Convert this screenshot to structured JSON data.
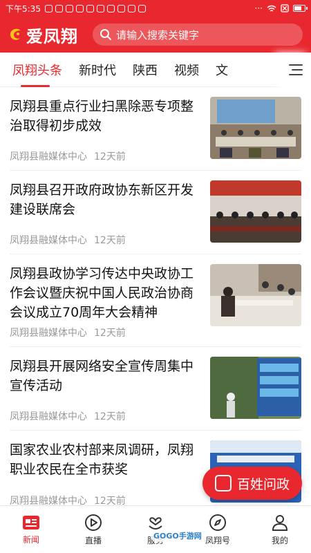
{
  "status_bar": {
    "time": "下午5:35"
  },
  "header": {
    "app_name": "爱凤翔",
    "search_placeholder": "请输入搜索关键字"
  },
  "tabs": [
    "凤翔头条",
    "新时代",
    "陕西",
    "视频",
    "文"
  ],
  "feed": [
    {
      "title": "凤翔县重点行业扫黑除恶专项整治取得初步成效",
      "source": "凤翔县融媒体中心",
      "time": "12天前"
    },
    {
      "title": "凤翔县召开政府政协东新区开发建设联席会",
      "source": "凤翔县融媒体中心",
      "time": "12天前"
    },
    {
      "title": "凤翔县政协学习传达中央政协工作会议暨庆祝中国人民政治协商会议成立70周年大会精神",
      "source": "凤翔县融媒体中心",
      "time": "12天前"
    },
    {
      "title": "凤翔县开展网络安全宣传周集中宣传活动",
      "source": "凤翔县融媒体中心",
      "time": "12天前"
    },
    {
      "title": "国家农业农村部来凤调研，凤翔职业农民在全市获奖",
      "source": "凤翔县融媒体中心",
      "time": "12天前"
    }
  ],
  "fab": {
    "label": "百姓问政"
  },
  "bottom_nav": [
    {
      "label": "新闻",
      "icon": "news-icon"
    },
    {
      "label": "直播",
      "icon": "play-icon"
    },
    {
      "label": "服务",
      "icon": "service-icon"
    },
    {
      "label": "凤翔号",
      "icon": "compass-icon"
    },
    {
      "label": "我的",
      "icon": "user-icon"
    }
  ],
  "watermark": "GOGO手游网",
  "colors": {
    "brand_red": "#e8282e"
  }
}
